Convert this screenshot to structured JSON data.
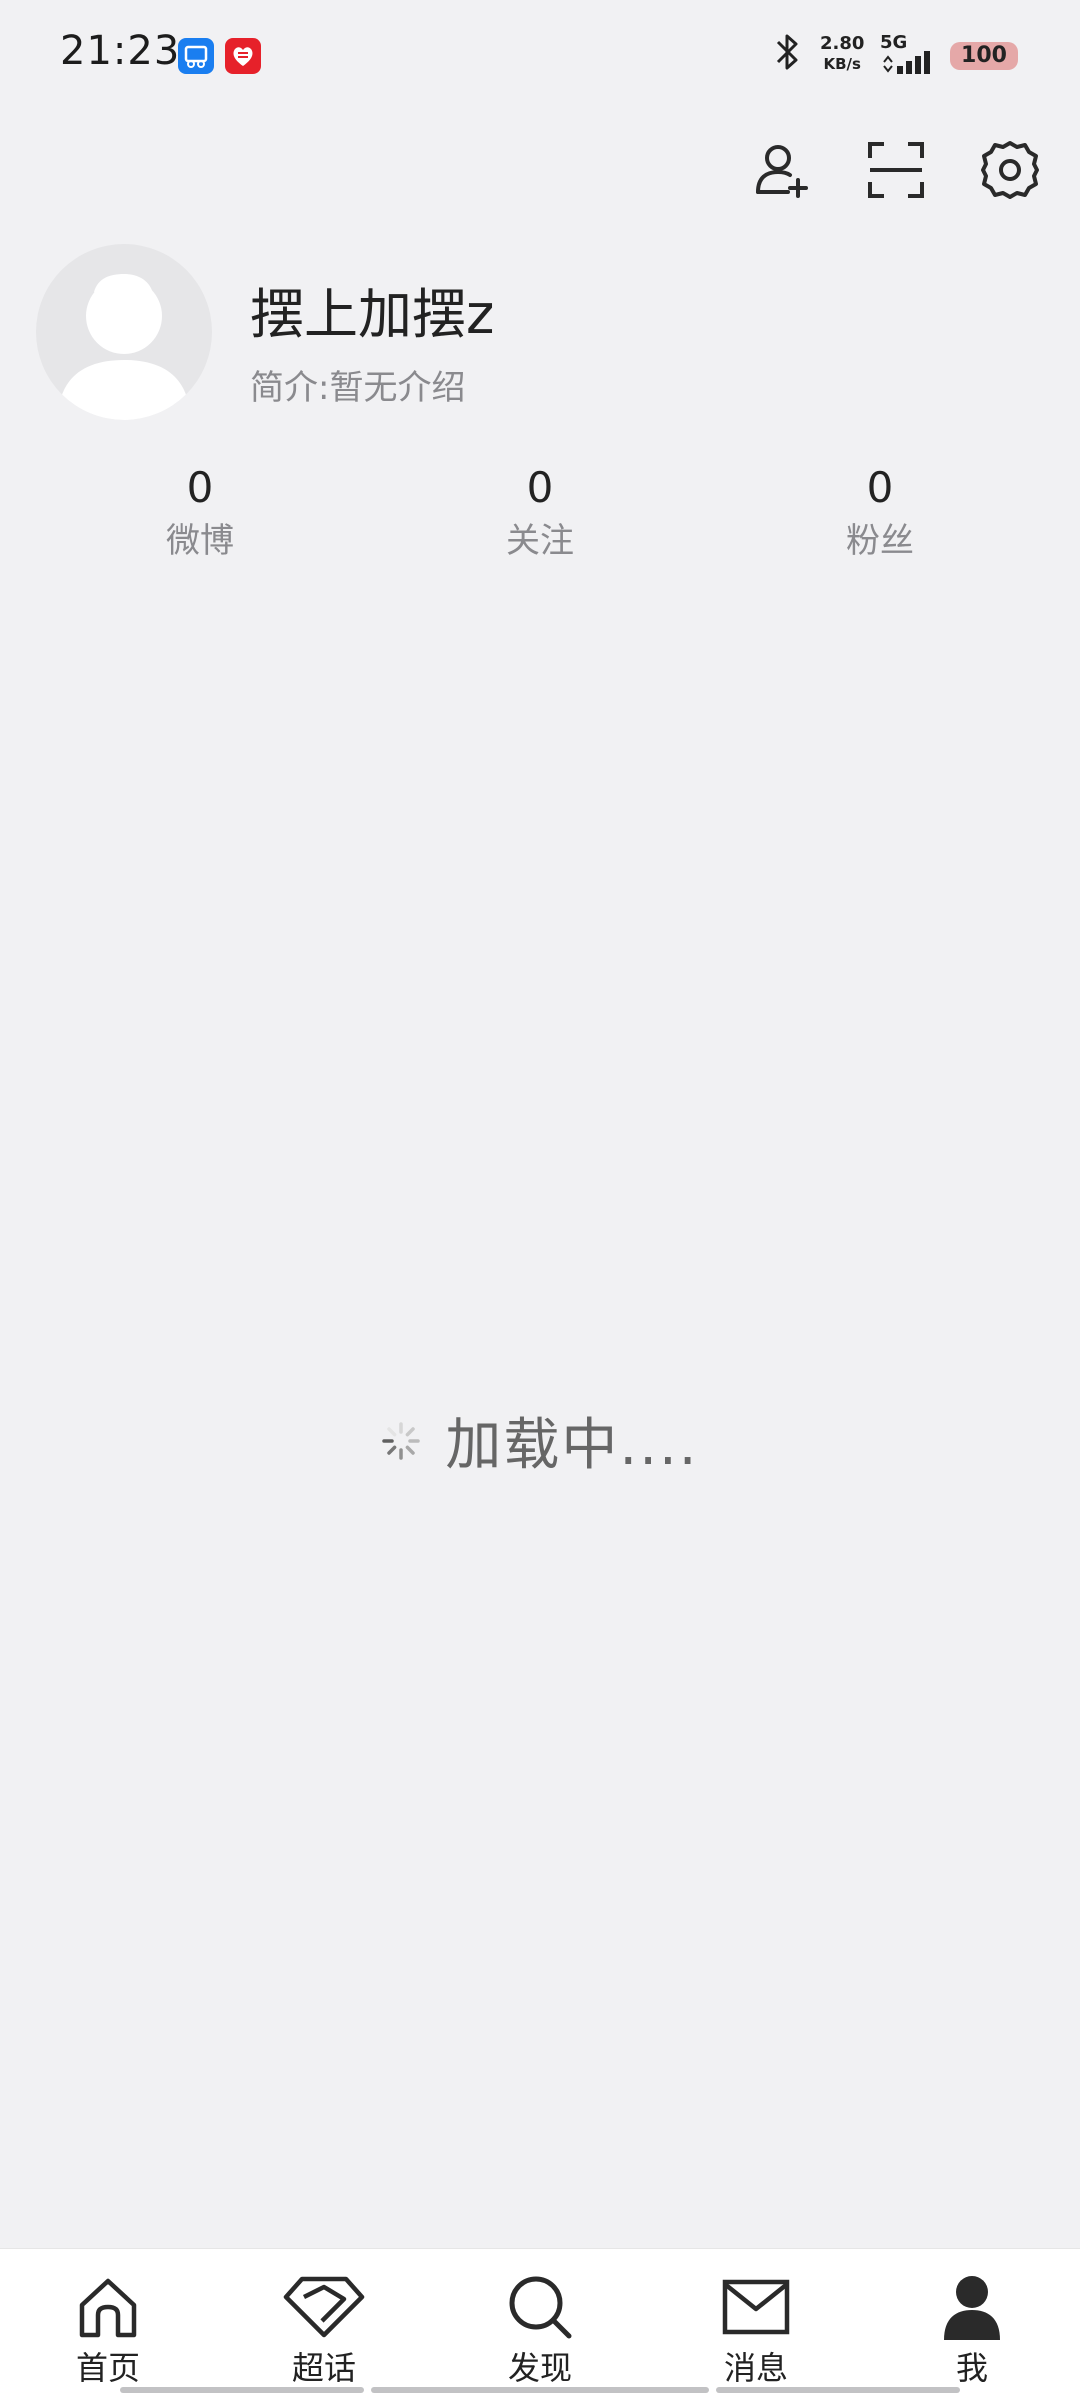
{
  "status_bar": {
    "time": "21:23",
    "speed_value": "2.80",
    "speed_unit": "KB/s",
    "network": "5G",
    "battery": "100",
    "icons": [
      "bluetooth-icon",
      "signal-icon"
    ],
    "app_badges": [
      "blue-app-badge",
      "red-app-badge"
    ]
  },
  "top_actions": {
    "icons": [
      "add-friend-icon",
      "scan-icon",
      "settings-icon"
    ]
  },
  "profile": {
    "username": "摆上加摆z",
    "bio_label": "简介:",
    "bio_value": "暂无介绍"
  },
  "stats": [
    {
      "value": "0",
      "label": "微博"
    },
    {
      "value": "0",
      "label": "关注"
    },
    {
      "value": "0",
      "label": "粉丝"
    }
  ],
  "loading": {
    "text": "加载中...."
  },
  "tabbar": {
    "items": [
      {
        "label": "首页",
        "icon": "home-icon"
      },
      {
        "label": "超话",
        "icon": "diamond-icon"
      },
      {
        "label": "发现",
        "icon": "search-icon"
      },
      {
        "label": "消息",
        "icon": "mail-icon"
      },
      {
        "label": "我",
        "icon": "person-icon",
        "active": true
      }
    ]
  },
  "colors": {
    "background": "#f1f1f3",
    "text_primary": "#222222",
    "text_secondary": "#8a8a8e",
    "battery_bg": "#e5a8a8",
    "tabbar_bg": "#ffffff"
  }
}
